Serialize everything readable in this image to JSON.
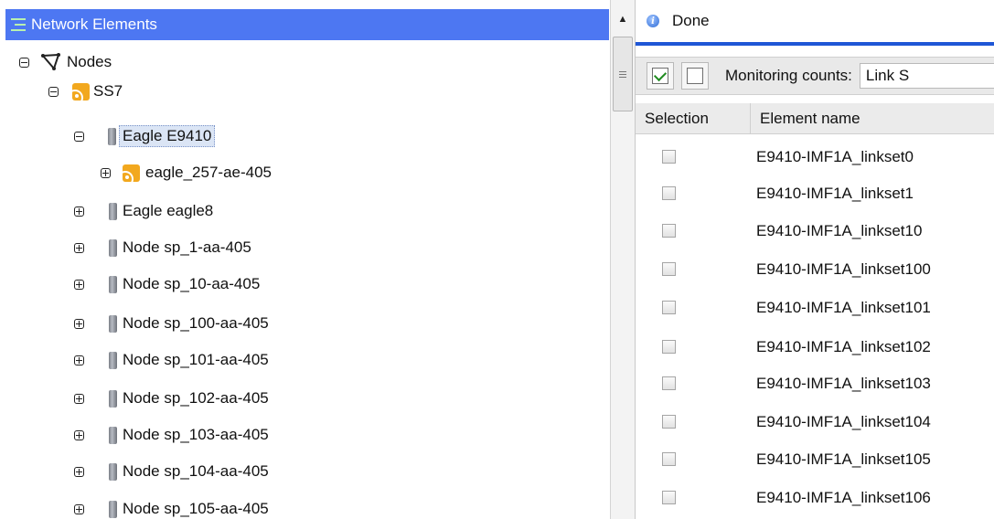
{
  "tree": {
    "header_label": "Network Elements",
    "nodes": [
      {
        "label": "Nodes",
        "expanded": true,
        "icon": "network-graph-icon"
      },
      {
        "label": "SS7",
        "expanded": true,
        "icon": "rss-feed-icon"
      },
      {
        "label": "Eagle E9410",
        "expanded": true,
        "selected": true,
        "icon": "device-icon"
      },
      {
        "label": "eagle_257-ae-405",
        "expanded": false,
        "icon": "rss-feed-icon"
      },
      {
        "label": "Eagle eagle8",
        "expanded": false,
        "icon": "device-icon"
      },
      {
        "label": "Node sp_1-aa-405",
        "expanded": false,
        "icon": "device-icon"
      },
      {
        "label": "Node sp_10-aa-405",
        "expanded": false,
        "icon": "device-icon"
      },
      {
        "label": "Node sp_100-aa-405",
        "expanded": false,
        "icon": "device-icon"
      },
      {
        "label": "Node sp_101-aa-405",
        "expanded": false,
        "icon": "device-icon"
      },
      {
        "label": "Node sp_102-aa-405",
        "expanded": false,
        "icon": "device-icon"
      },
      {
        "label": "Node sp_103-aa-405",
        "expanded": false,
        "icon": "device-icon"
      },
      {
        "label": "Node sp_104-aa-405",
        "expanded": false,
        "icon": "device-icon"
      },
      {
        "label": "Node sp_105-aa-405",
        "expanded": false,
        "icon": "device-icon"
      }
    ]
  },
  "status": {
    "text": "Done",
    "icon": "info-icon"
  },
  "toolbar": {
    "monitoring_label": "Monitoring counts:",
    "monitoring_value": "Link S",
    "select_all_icon": "check-all-icon",
    "deselect_all_icon": "uncheck-all-icon"
  },
  "grid": {
    "columns": [
      "Selection",
      "Element name"
    ],
    "rows": [
      {
        "name": "E9410-IMF1A_linkset0",
        "checked": false
      },
      {
        "name": "E9410-IMF1A_linkset1",
        "checked": false
      },
      {
        "name": "E9410-IMF1A_linkset10",
        "checked": false
      },
      {
        "name": "E9410-IMF1A_linkset100",
        "checked": false
      },
      {
        "name": "E9410-IMF1A_linkset101",
        "checked": false
      },
      {
        "name": "E9410-IMF1A_linkset102",
        "checked": false
      },
      {
        "name": "E9410-IMF1A_linkset103",
        "checked": false
      },
      {
        "name": "E9410-IMF1A_linkset104",
        "checked": false
      },
      {
        "name": "E9410-IMF1A_linkset105",
        "checked": false
      },
      {
        "name": "E9410-IMF1A_linkset106",
        "checked": false
      }
    ]
  },
  "colors": {
    "header_blue": "#4d77f2",
    "accent_line": "#1f56d6",
    "selection_highlight": "#dbe5f5"
  }
}
